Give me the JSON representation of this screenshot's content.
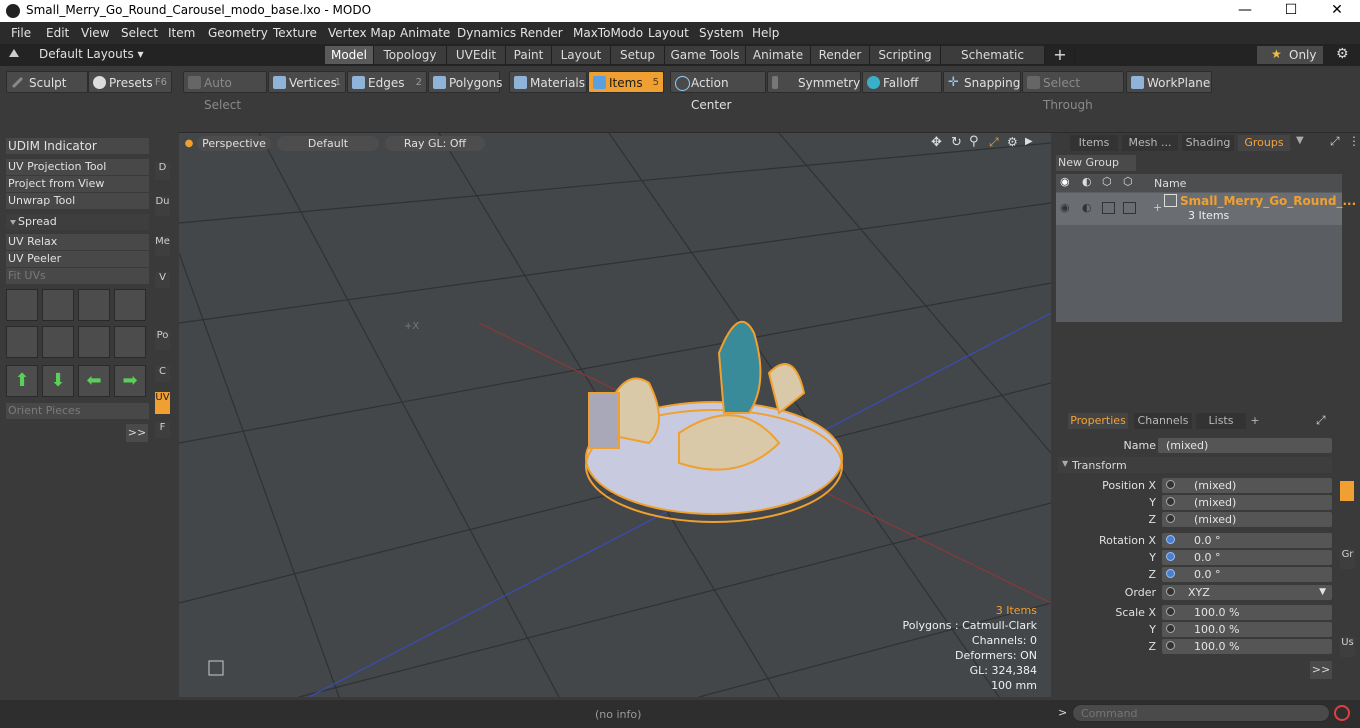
{
  "window": {
    "title": "Small_Merry_Go_Round_Carousel_modo_base.lxo - MODO",
    "min": "—",
    "max": "☐",
    "close": "✕"
  },
  "menu": [
    "File",
    "Edit",
    "View",
    "Select",
    "Item",
    "Geometry",
    "Texture",
    "Vertex Map",
    "Animate",
    "Dynamics",
    "Render",
    "MaxToModo",
    "Layout",
    "System",
    "Help"
  ],
  "layout_selector": "Default Layouts ▾",
  "tabs": [
    "Model",
    "Topology",
    "UVEdit",
    "Paint",
    "Layout",
    "Setup",
    "Game Tools",
    "Animate",
    "Render",
    "Scripting",
    "Schematic Fusion"
  ],
  "tab_add": "+",
  "only_label": "Only",
  "toolbar": {
    "sculpt": "Sculpt",
    "presets": "Presets",
    "presets_key": "F6",
    "auto_select": "Auto Select",
    "vertices": "Vertices",
    "vertices_key": "1",
    "edges": "Edges",
    "edges_key": "2",
    "polygons": "Polygons",
    "materials": "Materials",
    "items": "Items",
    "items_key": "5",
    "action_center": "Action Center",
    "symmetry": "Symmetry",
    "falloff": "Falloff",
    "snapping": "Snapping",
    "select_through": "Select Through",
    "workplane": "WorkPlane"
  },
  "left": {
    "udim": "UDIM Indicator",
    "uv_projection": "UV Projection Tool",
    "project_view": "Project from View",
    "unwrap": "Unwrap Tool",
    "spread": "Spread",
    "uv_relax": "UV Relax",
    "uv_peeler": "UV Peeler",
    "fit_uvs": "Fit UVs",
    "orient": "Orient Pieces",
    "more": ">>",
    "vtabs": [
      "D",
      "Du",
      "Me",
      "V",
      "Po",
      "C",
      "UV",
      "F"
    ]
  },
  "viewport": {
    "perspective": "Perspective",
    "default": "Default",
    "raygl": "Ray GL: Off",
    "info_items": "3 Items",
    "info_polygons": "Polygons : Catmull-Clark",
    "info_channels": "Channels: 0",
    "info_deformers": "Deformers: ON",
    "info_gl": "GL: 324,384",
    "info_scale": "100 mm"
  },
  "groups": {
    "tabs": [
      "Items",
      "Mesh ...",
      "Shading",
      "Groups"
    ],
    "new_group": "New Group",
    "col_name": "Name",
    "row_name": "Small_Merry_Go_Round_...",
    "row_sub": "3 Items"
  },
  "properties": {
    "tabs": [
      "Properties",
      "Channels",
      "Lists"
    ],
    "add": "+",
    "name_label": "Name",
    "name_value": "(mixed)",
    "transform": "Transform",
    "pos_label": "Position X",
    "y": "Y",
    "z": "Z",
    "pos_x": "(mixed)",
    "pos_y": "(mixed)",
    "pos_z": "(mixed)",
    "rot_label": "Rotation X",
    "rot_x": "0.0 °",
    "rot_y": "0.0 °",
    "rot_z": "0.0 °",
    "order_label": "Order",
    "order_value": "XYZ",
    "scale_label": "Scale X",
    "scale_x": "100.0 %",
    "scale_y": "100.0 %",
    "scale_z": "100.0 %",
    "more": ">>",
    "side_tabs": [
      "Gr",
      "Us"
    ]
  },
  "status": {
    "info": "(no info)",
    "command_placeholder": "Command",
    "prompt": ">"
  }
}
